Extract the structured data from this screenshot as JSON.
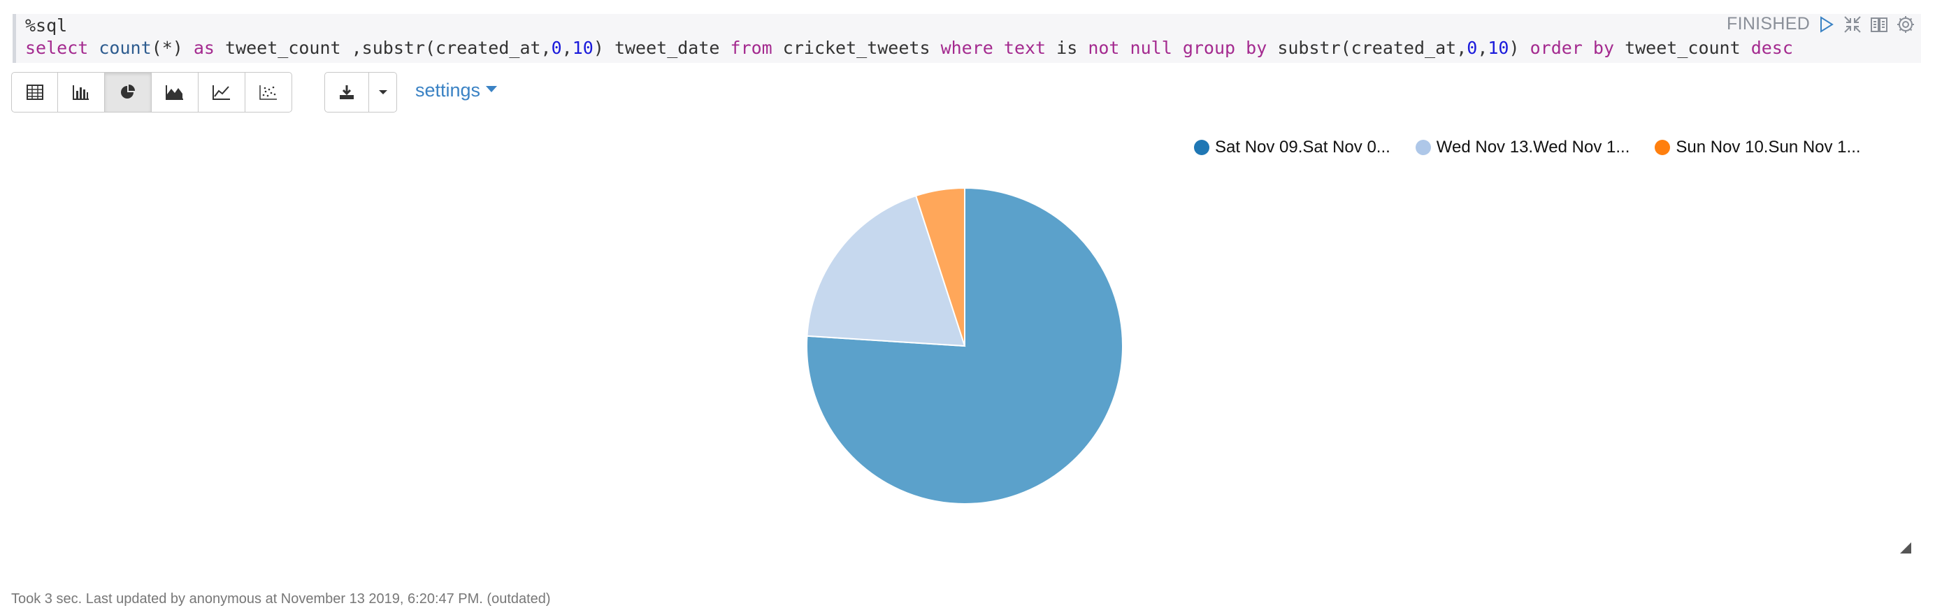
{
  "editor": {
    "line1": "%sql",
    "query_tokens": [
      {
        "t": "select",
        "c": "kw"
      },
      {
        "t": " ",
        "c": ""
      },
      {
        "t": "count",
        "c": "fn"
      },
      {
        "t": "(*) ",
        "c": ""
      },
      {
        "t": "as",
        "c": "kw"
      },
      {
        "t": " tweet_count ,substr(created_at,",
        "c": ""
      },
      {
        "t": "0",
        "c": "num"
      },
      {
        "t": ",",
        "c": ""
      },
      {
        "t": "10",
        "c": "num"
      },
      {
        "t": ") tweet_date ",
        "c": ""
      },
      {
        "t": "from",
        "c": "kw"
      },
      {
        "t": " cricket_tweets ",
        "c": ""
      },
      {
        "t": "where",
        "c": "kw"
      },
      {
        "t": " ",
        "c": ""
      },
      {
        "t": "text",
        "c": "kw"
      },
      {
        "t": " is ",
        "c": ""
      },
      {
        "t": "not",
        "c": "kw"
      },
      {
        "t": " ",
        "c": ""
      },
      {
        "t": "null",
        "c": "kw"
      },
      {
        "t": " ",
        "c": ""
      },
      {
        "t": "group",
        "c": "kw"
      },
      {
        "t": " ",
        "c": ""
      },
      {
        "t": "by",
        "c": "kw"
      },
      {
        "t": " substr(created_at,",
        "c": ""
      },
      {
        "t": "0",
        "c": "num"
      },
      {
        "t": ",",
        "c": ""
      },
      {
        "t": "10",
        "c": "num"
      },
      {
        "t": ") ",
        "c": ""
      },
      {
        "t": "order",
        "c": "kw"
      },
      {
        "t": " ",
        "c": ""
      },
      {
        "t": "by",
        "c": "kw"
      },
      {
        "t": " tweet_count ",
        "c": ""
      },
      {
        "t": "desc",
        "c": "kw"
      }
    ]
  },
  "status": "FINISHED",
  "controls": [
    "run-icon",
    "collapse-icon",
    "book-icon",
    "gear-icon"
  ],
  "toolbar": {
    "buttons": [
      "table-icon",
      "bar-chart-icon",
      "pie-chart-icon",
      "area-chart-icon",
      "line-chart-icon",
      "scatter-chart-icon"
    ],
    "active": "pie-chart-icon",
    "download": "download-icon",
    "settings_label": "settings"
  },
  "chart_data": {
    "type": "pie",
    "legend_placement": "top-right",
    "series": [
      {
        "name": "Sat Nov 09.Sat Nov 0...",
        "value": 76,
        "color": "#1f77b4",
        "fill": "#5ba1cb"
      },
      {
        "name": "Wed Nov 13.Wed Nov 1...",
        "value": 19,
        "color": "#aec7e8",
        "fill": "#c6d8ee"
      },
      {
        "name": "Sun Nov 10.Sun Nov 1...",
        "value": 5,
        "color": "#ff7f0e",
        "fill": "#ffa75a"
      }
    ]
  },
  "footer": "Took 3 sec. Last updated by anonymous at November 13 2019, 6:20:47 PM. (outdated)"
}
